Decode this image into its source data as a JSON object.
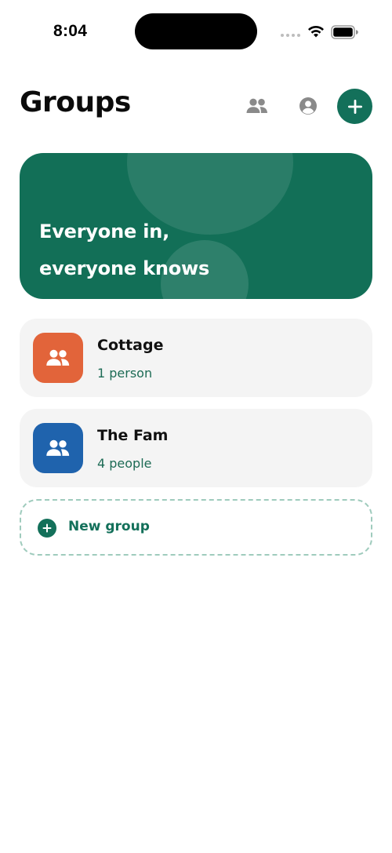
{
  "status_bar": {
    "time": "8:04"
  },
  "header": {
    "title": "Groups",
    "people_icon": "people-icon",
    "profile_icon": "account-circle-icon",
    "add_icon": "plus-icon"
  },
  "hero": {
    "line1": "Everyone in,",
    "line2": "everyone knows"
  },
  "groups": [
    {
      "name": "Cottage",
      "count": "1 person",
      "color": "#e2643a",
      "icon": "people-icon"
    },
    {
      "name": "The Fam",
      "count": "4 people",
      "color": "#1f63ad",
      "icon": "people-icon"
    }
  ],
  "new_group": {
    "label": "New group",
    "icon": "plus-circle-icon"
  },
  "colors": {
    "accent": "#13705a",
    "hero_bg": "#126f57",
    "card_bg": "#f4f4f4"
  }
}
